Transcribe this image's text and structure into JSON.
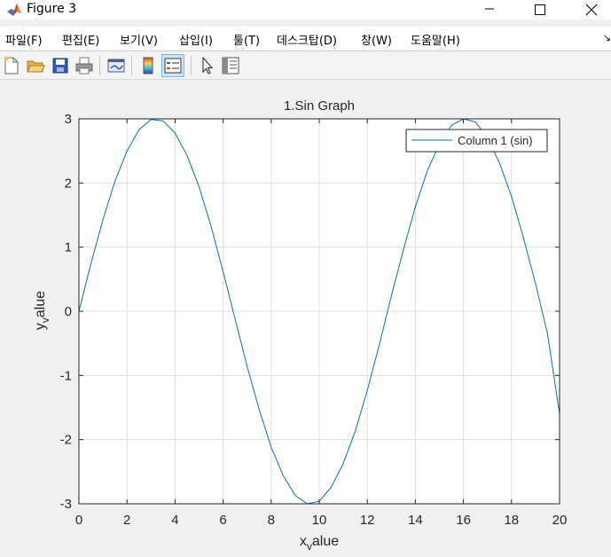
{
  "window": {
    "title": "Figure 3",
    "icon": "matlab-logo-icon"
  },
  "menu": {
    "items": [
      {
        "label": "파일(F)"
      },
      {
        "label": "편집(E)"
      },
      {
        "label": "보기(V)"
      },
      {
        "label": "삽입(I)"
      },
      {
        "label": "툴(T)"
      },
      {
        "label": "데스크탑(D)"
      },
      {
        "label": "창(W)"
      },
      {
        "label": "도움말(H)"
      }
    ],
    "overflow_glyph": "↘"
  },
  "toolbar": {
    "buttons": [
      {
        "icon": "new-figure-icon"
      },
      {
        "icon": "open-file-icon"
      },
      {
        "icon": "save-icon"
      },
      {
        "icon": "print-icon"
      },
      {
        "icon": "link-plot-icon"
      },
      {
        "icon": "insert-colorbar-icon"
      },
      {
        "icon": "insert-legend-icon",
        "active": true
      },
      {
        "icon": "edit-plot-arrow-icon"
      },
      {
        "icon": "property-inspector-icon"
      }
    ]
  },
  "chart_data": {
    "type": "line",
    "title": "1.Sin Graph",
    "xlabel": {
      "main": "x",
      "sub": "v",
      "rest": "alue"
    },
    "ylabel": {
      "main": "y",
      "sub": "v",
      "rest": "alue"
    },
    "xlim": [
      0,
      20
    ],
    "ylim": [
      -3,
      3
    ],
    "xticks": [
      "0",
      "2",
      "4",
      "6",
      "8",
      "10",
      "12",
      "14",
      "16",
      "18",
      "20"
    ],
    "yticks": [
      "3",
      "2",
      "1",
      "0",
      "-1",
      "-2",
      "-3"
    ],
    "grid": true,
    "legend": {
      "position": "top-right",
      "entries": [
        "Column 1 (sin)"
      ]
    },
    "series": [
      {
        "name": "Column 1 (sin)",
        "color": "#0072bd",
        "x": [
          0,
          0.5,
          1,
          1.5,
          2,
          2.5,
          3,
          3.5,
          4,
          4.5,
          5,
          5.5,
          6,
          6.5,
          7,
          7.5,
          8,
          8.5,
          9,
          9.5,
          10,
          10.5,
          11,
          11.5,
          12,
          12.5,
          13,
          13.5,
          14,
          14.5,
          15,
          15.5,
          16,
          16.5,
          17,
          17.5,
          18,
          18.5,
          19,
          19.5,
          20
        ],
        "y": [
          0,
          0.74,
          1.43,
          2.03,
          2.5,
          2.83,
          2.99,
          2.97,
          2.78,
          2.43,
          1.94,
          1.32,
          0.62,
          -0.12,
          -0.86,
          -1.53,
          -2.12,
          -2.56,
          -2.87,
          -3.0,
          -2.96,
          -2.74,
          -2.37,
          -1.87,
          -1.23,
          -0.52,
          0.24,
          0.96,
          1.63,
          2.19,
          2.61,
          2.9,
          3.0,
          2.95,
          2.71,
          2.31,
          1.79,
          1.14,
          0.43,
          -0.35,
          -1.6
        ]
      }
    ]
  }
}
